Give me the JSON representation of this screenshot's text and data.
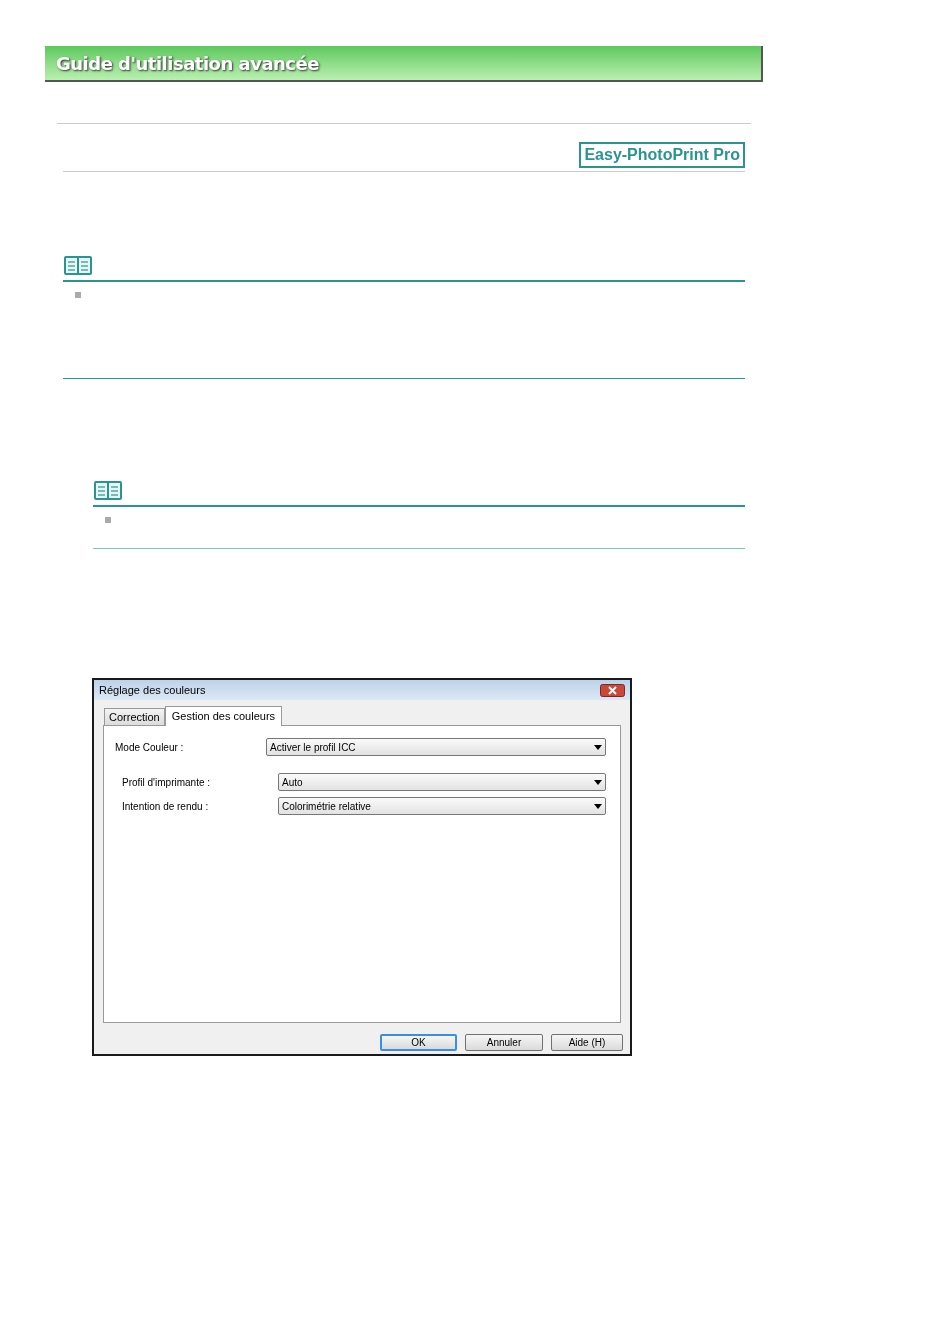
{
  "header": {
    "title": "Guide d'utilisation avancée"
  },
  "product_badge": "Easy-PhotoPrint Pro",
  "dialog": {
    "title": "Réglage des couleurs",
    "tabs": [
      {
        "label": "Correction",
        "selected": false
      },
      {
        "label": "Gestion des couleurs",
        "selected": true
      }
    ],
    "fields": [
      {
        "label": "Mode Couleur :",
        "value": "Activer le profil ICC",
        "indented": false
      },
      {
        "label": "Profil d'imprimante :",
        "value": "Auto",
        "indented": true
      },
      {
        "label": "Intention de rendu :",
        "value": "Colorimétrie relative",
        "indented": true
      }
    ],
    "buttons": [
      {
        "label": "OK",
        "default": true
      },
      {
        "label": "Annuler",
        "default": false
      },
      {
        "label": "Aide (H)",
        "default": false
      }
    ]
  }
}
